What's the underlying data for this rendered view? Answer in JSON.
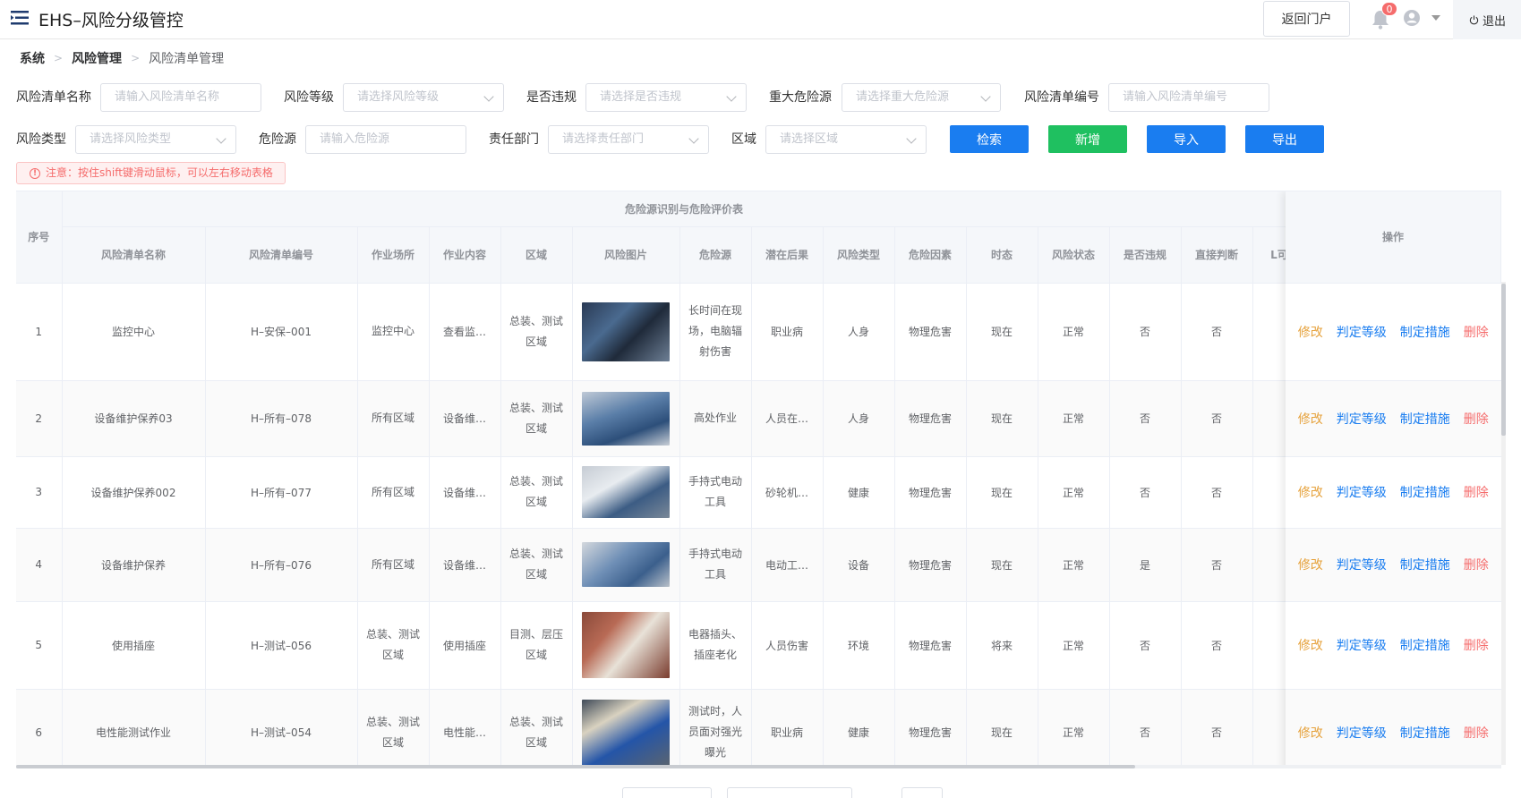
{
  "header": {
    "title": "EHS–风险分级管控",
    "portal_button": "返回门户",
    "notification_count": "0",
    "logout": "退出"
  },
  "breadcrumb": [
    "系统",
    "风险管理",
    "风险清单管理"
  ],
  "filters": {
    "risk_name": {
      "label": "风险清单名称",
      "placeholder": "请输入风险清单名称"
    },
    "risk_level": {
      "label": "风险等级",
      "placeholder": "请选择风险等级"
    },
    "violation": {
      "label": "是否违规",
      "placeholder": "请选择是否违规"
    },
    "major_hazard": {
      "label": "重大危险源",
      "placeholder": "请选择重大危险源"
    },
    "risk_code": {
      "label": "风险清单编号",
      "placeholder": "请输入风险清单编号"
    },
    "risk_type": {
      "label": "风险类型",
      "placeholder": "请选择风险类型"
    },
    "hazard": {
      "label": "危险源",
      "placeholder": "请输入危险源"
    },
    "department": {
      "label": "责任部门",
      "placeholder": "请选择责任部门"
    },
    "area": {
      "label": "区域",
      "placeholder": "请选择区域"
    }
  },
  "actions": {
    "search": "检索",
    "add": "新增",
    "import": "导入",
    "export": "导出"
  },
  "notice": "注意：按住shift键滑动鼠标，可以左右移动表格",
  "table": {
    "index_header": "序号",
    "group_header": "危险源识别与危险评价表",
    "op_header": "操作",
    "columns": [
      "风险清单名称",
      "风险清单编号",
      "作业场所",
      "作业内容",
      "区域",
      "风险图片",
      "危险源",
      "潜在后果",
      "风险类型",
      "危险因素",
      "时态",
      "风险状态",
      "是否违规",
      "直接判断",
      "L可"
    ],
    "op_labels": {
      "edit": "修改",
      "level": "判定等级",
      "measure": "制定措施",
      "delete": "删除"
    },
    "rows": [
      {
        "idx": "1",
        "name": "监控中心",
        "code": "H–安保–001",
        "place": "监控中心",
        "content": "查看监…",
        "area": "总装、测试区域",
        "hazard": "长时间在现场，电脑辐射伤害",
        "consequence": "职业病",
        "type": "人身",
        "factor": "物理危害",
        "tense": "现在",
        "status": "正常",
        "violation": "否",
        "judge": "否"
      },
      {
        "idx": "2",
        "name": "设备维护保养03",
        "code": "H–所有–078",
        "place": "所有区域",
        "content": "设备维…",
        "area": "总装、测试区域",
        "hazard": "高处作业",
        "consequence": "人员在…",
        "type": "人身",
        "factor": "物理危害",
        "tense": "现在",
        "status": "正常",
        "violation": "否",
        "judge": "否"
      },
      {
        "idx": "3",
        "name": "设备维护保养002",
        "code": "H–所有–077",
        "place": "所有区域",
        "content": "设备维…",
        "area": "总装、测试区域",
        "hazard": "手持式电动工具",
        "consequence": "砂轮机…",
        "type": "健康",
        "factor": "物理危害",
        "tense": "现在",
        "status": "正常",
        "violation": "否",
        "judge": "否"
      },
      {
        "idx": "4",
        "name": "设备维护保养",
        "code": "H–所有–076",
        "place": "所有区域",
        "content": "设备维…",
        "area": "总装、测试区域",
        "hazard": "手持式电动工具",
        "consequence": "电动工…",
        "type": "设备",
        "factor": "物理危害",
        "tense": "现在",
        "status": "正常",
        "violation": "是",
        "judge": "否"
      },
      {
        "idx": "5",
        "name": "使用插座",
        "code": "H–测试–056",
        "place": "总装、测试区域",
        "content": "使用插座",
        "area": "目测、层压区域",
        "hazard": "电器插头、插座老化",
        "consequence": "人员伤害",
        "type": "环境",
        "factor": "物理危害",
        "tense": "将来",
        "status": "正常",
        "violation": "否",
        "judge": "否"
      },
      {
        "idx": "6",
        "name": "电性能测试作业",
        "code": "H–测试–054",
        "place": "总装、测试区域",
        "content": "电性能…",
        "area": "总装、测试区域",
        "hazard": "测试时，人员面对强光曝光",
        "consequence": "职业病",
        "type": "健康",
        "factor": "物理危害",
        "tense": "现在",
        "status": "正常",
        "violation": "否",
        "judge": "否"
      }
    ]
  },
  "colors": {
    "primary": "#1a7df0",
    "success": "#1fc060",
    "warning": "#e6a23c",
    "danger": "#f56c6c"
  }
}
